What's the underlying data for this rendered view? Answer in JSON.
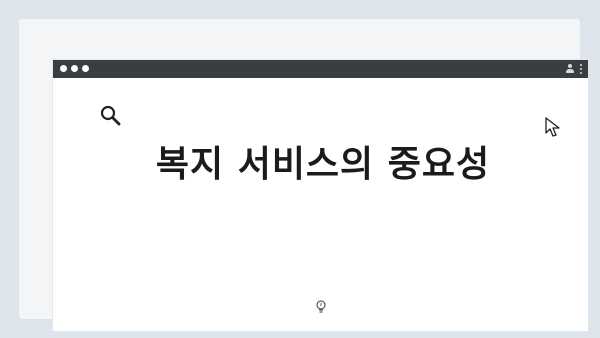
{
  "window": {
    "title_bar_color": "#3a3d42",
    "background_color": "#ffffff"
  },
  "icons": {
    "search": "search-icon",
    "cursor": "cursor-pointer-icon",
    "bulb": "lightbulb-icon",
    "user": "user-icon",
    "menu": "kebab-menu-icon"
  },
  "content": {
    "headline": "복지 서비스의 중요성"
  }
}
